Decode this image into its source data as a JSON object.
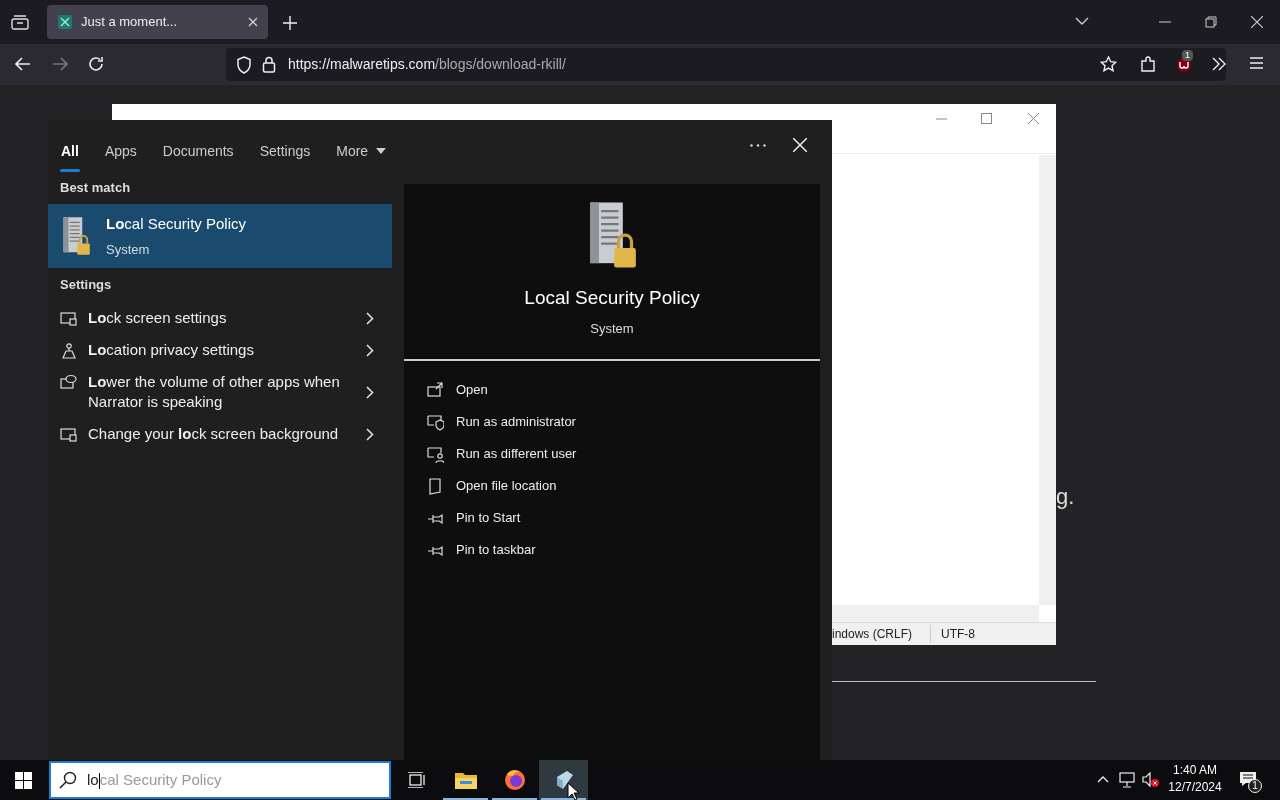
{
  "browser": {
    "tab_title": "Just a moment...",
    "url_host": "https://malwaretips.com",
    "url_path": "/blogs/download-rkill/",
    "extension_badge": "1"
  },
  "background_page": {
    "text_fragment": "g.",
    "notepad_status": [
      "indows (CRLF)",
      "UTF-8"
    ]
  },
  "search": {
    "tabs": [
      {
        "label": "All",
        "selected": true
      },
      {
        "label": "Apps",
        "selected": false
      },
      {
        "label": "Documents",
        "selected": false
      },
      {
        "label": "Settings",
        "selected": false
      },
      {
        "label": "More",
        "selected": false
      }
    ],
    "best_match_heading": "Best match",
    "best_match": {
      "title": "**Lo**cal Security Policy",
      "subtitle": "System",
      "selected": true
    },
    "settings_heading": "Settings",
    "settings_results": [
      {
        "kind": "monitor-lock",
        "label": "**Lo**ck screen settings"
      },
      {
        "kind": "person-pin",
        "label": "**Lo**cation privacy settings"
      },
      {
        "kind": "monitor-speech",
        "label": "**Lo**wer the volume of other apps when Narrator is speaking"
      },
      {
        "kind": "monitor-lock",
        "label": "Change your **lo**ck screen background"
      }
    ],
    "preview": {
      "title": "Local Security Policy",
      "subtitle": "System",
      "actions": [
        {
          "kind": "open",
          "label": "Open"
        },
        {
          "kind": "admin",
          "label": "Run as administrator"
        },
        {
          "kind": "user",
          "label": "Run as different user"
        },
        {
          "kind": "folder",
          "label": "Open file location"
        },
        {
          "kind": "pin",
          "label": "Pin to Start"
        },
        {
          "kind": "pin",
          "label": "Pin to taskbar"
        }
      ]
    },
    "query": {
      "typed": "lo",
      "suggestion": "cal Security Policy"
    }
  },
  "taskbar": {
    "apps": [
      {
        "kind": "task-view",
        "running": false,
        "selected": false
      },
      {
        "kind": "explorer",
        "running": true,
        "selected": false
      },
      {
        "kind": "firefox",
        "running": true,
        "selected": false
      },
      {
        "kind": "policy",
        "running": true,
        "selected": true
      }
    ],
    "time": "1:40 AM",
    "date": "12/7/2024",
    "notification_count": "1"
  }
}
